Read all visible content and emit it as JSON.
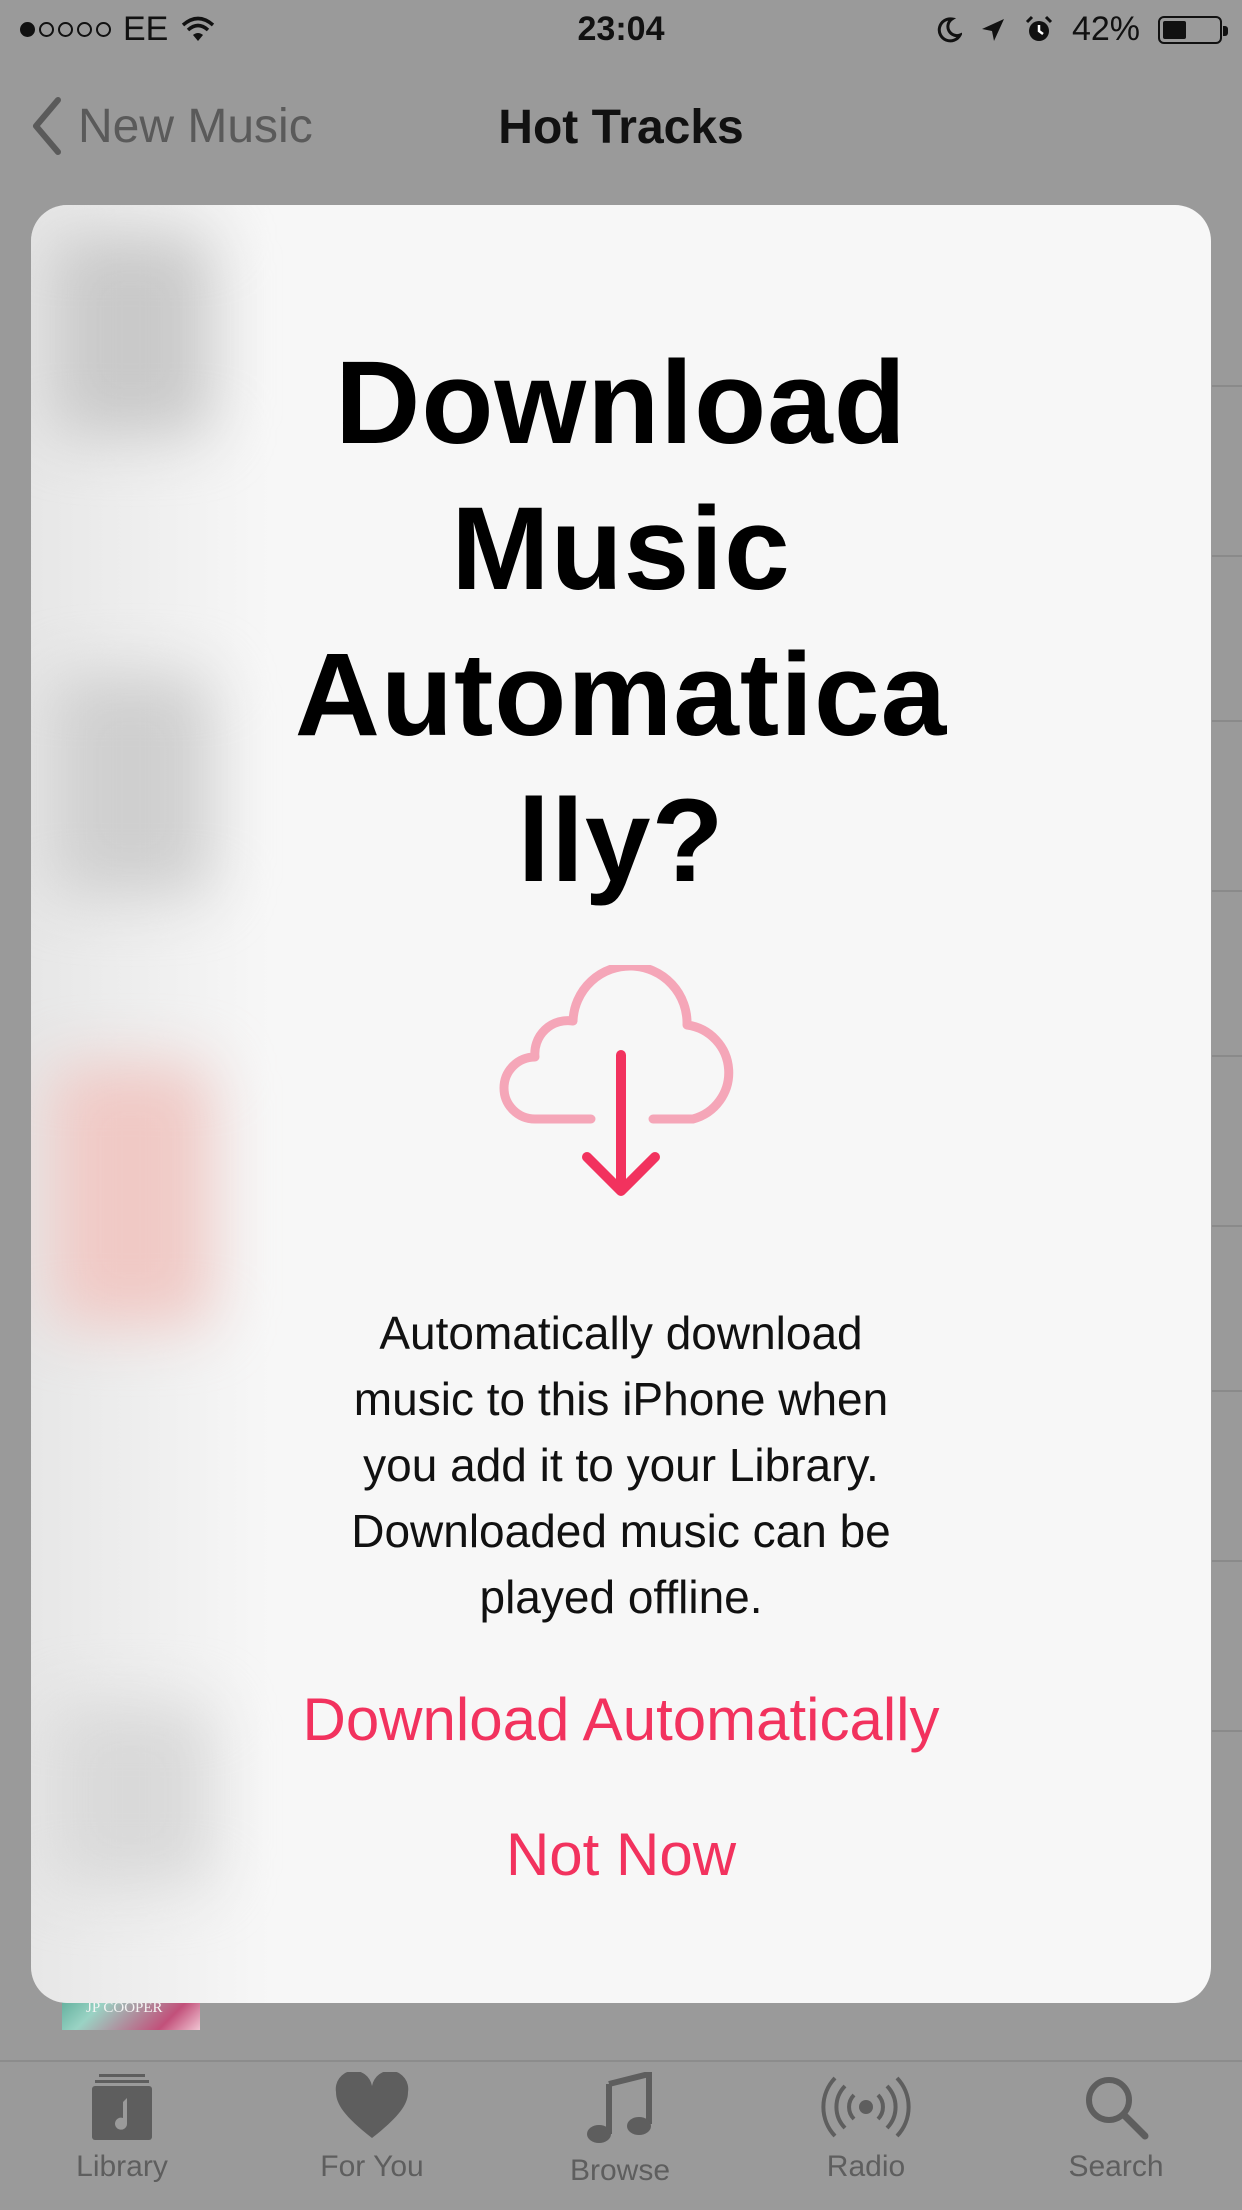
{
  "status_bar": {
    "carrier": "EE",
    "time": "23:04",
    "battery": "42%",
    "battery_level": 0.42
  },
  "nav": {
    "back_label": "New Music",
    "title": "Hot Tracks"
  },
  "background": {
    "album_text": "JP COOPER"
  },
  "modal": {
    "title": "Download Music Automatically?",
    "title_lines": [
      "Download",
      "Music",
      "Automatica",
      "lly?"
    ],
    "icon": "cloud-download-icon",
    "body_lines": [
      "Automatically download",
      "music to this iPhone when",
      "you add it to your Library.",
      "Downloaded music can be",
      "played offline."
    ],
    "primary_action": "Download Automatically",
    "secondary_action": "Not Now",
    "accent_color": "#f2325e"
  },
  "tabs": [
    {
      "label": "Library",
      "icon": "library-icon"
    },
    {
      "label": "For You",
      "icon": "heart-icon"
    },
    {
      "label": "Browse",
      "icon": "music-note-icon"
    },
    {
      "label": "Radio",
      "icon": "radio-icon"
    },
    {
      "label": "Search",
      "icon": "search-icon"
    }
  ]
}
